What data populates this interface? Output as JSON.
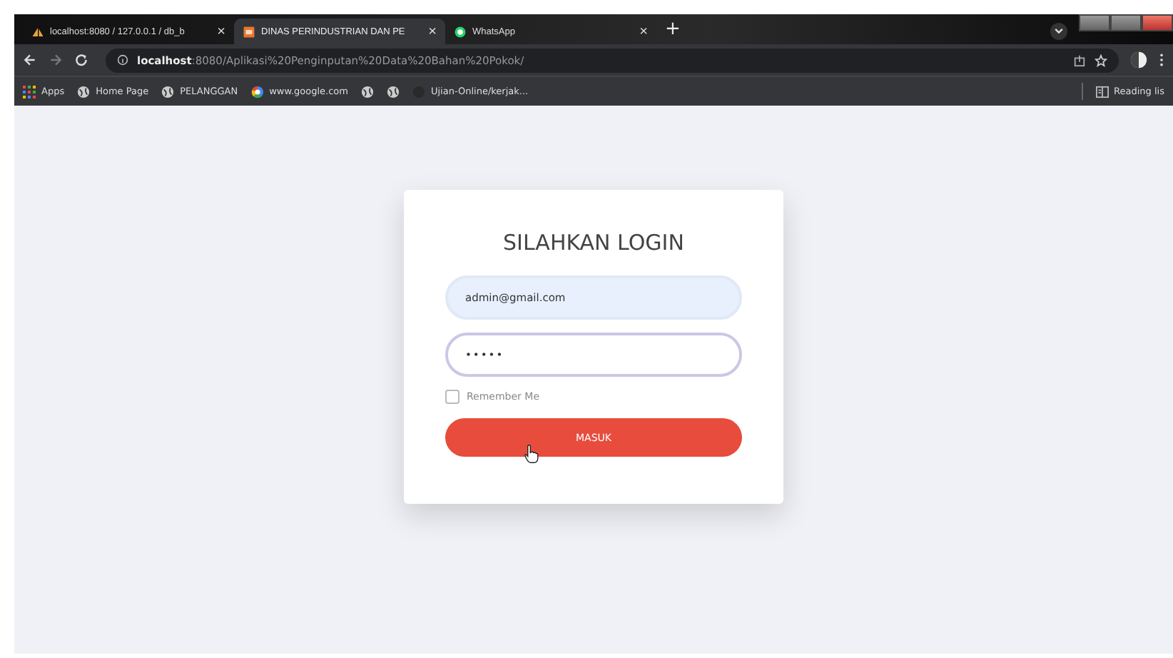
{
  "tabs": [
    {
      "title": "localhost:8080 / 127.0.0.1 / db_b",
      "close": "×",
      "selected": false
    },
    {
      "title": "DINAS PERINDUSTRIAN DAN PE",
      "close": "×",
      "selected": true
    },
    {
      "title": "WhatsApp",
      "close": "×",
      "selected": false
    }
  ],
  "new_tab": "+",
  "address_bar": {
    "host": "localhost",
    "path": ":8080/Aplikasi%20Penginputan%20Data%20Bahan%20Pokok/"
  },
  "bookmarks": [
    {
      "label": "Apps"
    },
    {
      "label": "Home Page"
    },
    {
      "label": "PELANGGAN"
    },
    {
      "label": "www.google.com"
    },
    {
      "label": "Ujian-Online/kerjak..."
    }
  ],
  "reading_list": "Reading lis",
  "login": {
    "title": "SILAHKAN LOGIN",
    "email": "admin@gmail.com",
    "password": "•••••",
    "remember": {
      "label": "Remember Me",
      "checked": false
    },
    "submit": "MASUK"
  }
}
